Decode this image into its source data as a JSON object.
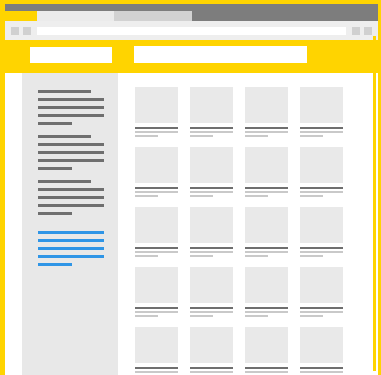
{
  "browser": {
    "tabs": [
      {
        "label": ""
      },
      {
        "label": ""
      },
      {
        "label": ""
      }
    ],
    "address_bar": {
      "value": "",
      "placeholder": ""
    }
  },
  "header": {
    "logo_text": "",
    "search": {
      "value": "",
      "placeholder": ""
    }
  },
  "sidebar": {
    "groups": [
      {
        "items": [
          {
            "label": ""
          },
          {
            "label": ""
          },
          {
            "label": ""
          },
          {
            "label": ""
          },
          {
            "label": ""
          }
        ]
      },
      {
        "items": [
          {
            "label": ""
          },
          {
            "label": ""
          },
          {
            "label": ""
          },
          {
            "label": ""
          },
          {
            "label": ""
          }
        ]
      },
      {
        "items": [
          {
            "label": ""
          },
          {
            "label": ""
          },
          {
            "label": ""
          },
          {
            "label": ""
          },
          {
            "label": ""
          }
        ]
      },
      {
        "items": [
          {
            "label": ""
          },
          {
            "label": ""
          },
          {
            "label": ""
          },
          {
            "label": ""
          },
          {
            "label": ""
          }
        ]
      }
    ]
  },
  "grid": {
    "rows": 5,
    "cols": 4
  },
  "colors": {
    "accent": "#ffd400",
    "titlebar": "#7d7d7d",
    "placeholder_dark": "#6f6f6f",
    "placeholder_light": "#c9c9c9",
    "thumb": "#e9e9e9",
    "sidebar_bg": "#e8e8e8",
    "link": "#2f95e6"
  }
}
